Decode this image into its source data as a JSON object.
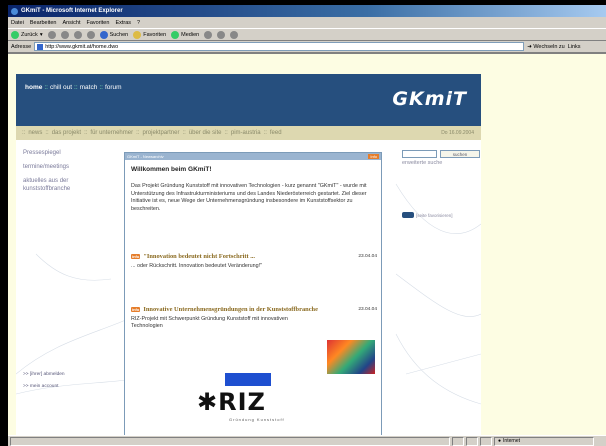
{
  "window": {
    "title": "GKmiT - Microsoft Internet Explorer"
  },
  "menu": [
    "Datei",
    "Bearbeiten",
    "Ansicht",
    "Favoriten",
    "Extras",
    "?"
  ],
  "toolbar": {
    "back": "Zurück",
    "search": "Suchen",
    "favorites": "Favoriten",
    "media": "Medien"
  },
  "address": {
    "label": "Adresse",
    "url": "http://www.gkmit.at/home.dwo",
    "go": "Wechseln zu",
    "links": "Links"
  },
  "site": {
    "topnav": [
      {
        "label": "home",
        "active": true
      },
      {
        "label": "chill out"
      },
      {
        "label": "match"
      },
      {
        "label": "forum"
      }
    ],
    "logo": "GKmiT",
    "subnav": [
      "news",
      "das projekt",
      "für unternehmer",
      "projektpartner",
      "über die site",
      "pim-austria",
      "feed"
    ],
    "date": "Do 16.09.2004",
    "left": [
      "Pressespiegel",
      "termine/meetings",
      "aktuelles aus der kunststoffbranche"
    ],
    "left_bottom": [
      ">> [ihrer] abmelden",
      ">> mein account"
    ],
    "center": {
      "bar_title": "GKmiT - Newsarchiv",
      "bar_tag": "Info",
      "heading": "Willkommen beim GKmiT!",
      "intro": "Das Projekt Gründung Kunststoff mit innovativen Technologien - kurz genannt \"GKmiT\" - wurde mit Unterstützung des Infrastrukturministeriums und des Landes Niederösterreich gestartet. Ziel dieser Initiative ist es, neue Wege der Unternehmensgründung insbesondere im Kunststoffsektor zu beschreiten.",
      "news": [
        {
          "badge": "info",
          "title": "\"Innovation bedeutet nicht Fortschritt ...",
          "date": "23.04.04",
          "text": "... oder Rückschritt. Innovation bedeutet Veränderung!\""
        },
        {
          "badge": "info",
          "title": "Innovative Unternehmensgründungen in der Kunststoffbranche",
          "date": "23.04.04",
          "text": "RIZ-Projekt mit Schwerpunkt Gründung Kunststoff mit innovativen Technologien"
        }
      ],
      "riz": {
        "word": "RIZ",
        "sub": "Gründung Kunststoff"
      }
    },
    "search": {
      "button": "suchen",
      "advanced": "erweiterte suche"
    },
    "fav": "[seite favorisieren]"
  },
  "status": {
    "zone": "Internet"
  }
}
